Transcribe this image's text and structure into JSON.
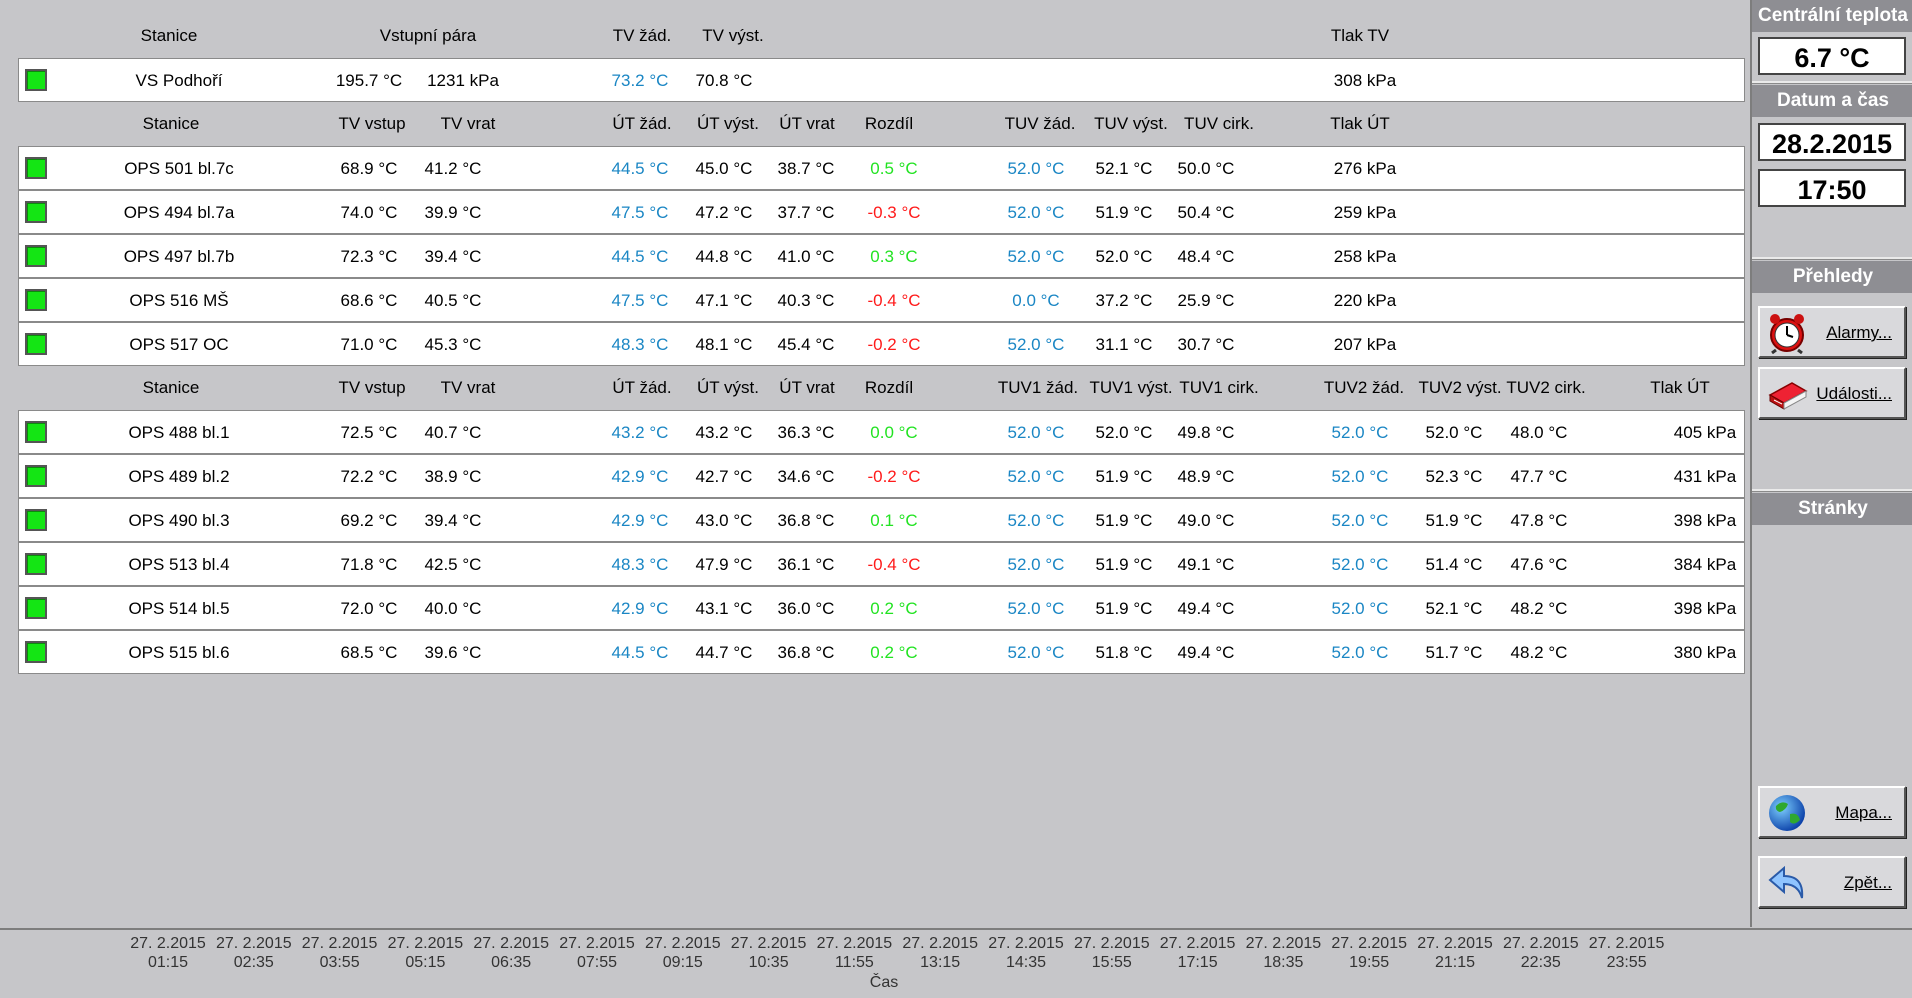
{
  "header1": {
    "stanice": "Stanice",
    "vstupni_para": "Vstupní pára",
    "tv_zad": "TV žád.",
    "tv_vyst": "TV výst.",
    "tlak_tv": "Tlak TV"
  },
  "vs_row": {
    "name": "VS Podhoří",
    "para_temp": "195.7 °C",
    "para_press": "1231 kPa",
    "tv_zad": "73.2 °C",
    "tv_vyst": "70.8 °C",
    "tlak": "308 kPa"
  },
  "header2": {
    "stanice": "Stanice",
    "tv_vstup": "TV vstup",
    "tv_vrat": "TV vrat",
    "ut_zad": "ÚT žád.",
    "ut_vyst": "ÚT výst.",
    "ut_vrat": "ÚT vrat",
    "rozdil": "Rozdíl",
    "tuv_zad": "TUV žád.",
    "tuv_vyst": "TUV výst.",
    "tuv_cirk": "TUV cirk.",
    "tlak_ut": "Tlak ÚT"
  },
  "group2": [
    {
      "name": "OPS 501 bl.7c",
      "tv_vstup": "68.9 °C",
      "tv_vrat": "41.2 °C",
      "ut_zad": "44.5 °C",
      "ut_vyst": "45.0 °C",
      "ut_vrat": "38.7 °C",
      "rozdil": "0.5 °C",
      "rozdil_sign": "pos",
      "tuv_zad": "52.0 °C",
      "tuv_vyst": "52.1 °C",
      "tuv_cirk": "50.0 °C",
      "tlak": "276 kPa"
    },
    {
      "name": "OPS 494 bl.7a",
      "tv_vstup": "74.0 °C",
      "tv_vrat": "39.9 °C",
      "ut_zad": "47.5 °C",
      "ut_vyst": "47.2 °C",
      "ut_vrat": "37.7 °C",
      "rozdil": "-0.3 °C",
      "rozdil_sign": "neg",
      "tuv_zad": "52.0 °C",
      "tuv_vyst": "51.9 °C",
      "tuv_cirk": "50.4 °C",
      "tlak": "259 kPa"
    },
    {
      "name": "OPS 497 bl.7b",
      "tv_vstup": "72.3 °C",
      "tv_vrat": "39.4 °C",
      "ut_zad": "44.5 °C",
      "ut_vyst": "44.8 °C",
      "ut_vrat": "41.0 °C",
      "rozdil": "0.3 °C",
      "rozdil_sign": "pos",
      "tuv_zad": "52.0 °C",
      "tuv_vyst": "52.0 °C",
      "tuv_cirk": "48.4 °C",
      "tlak": "258 kPa"
    },
    {
      "name": "OPS 516 MŠ",
      "tv_vstup": "68.6 °C",
      "tv_vrat": "40.5 °C",
      "ut_zad": "47.5 °C",
      "ut_vyst": "47.1 °C",
      "ut_vrat": "40.3 °C",
      "rozdil": "-0.4 °C",
      "rozdil_sign": "neg",
      "tuv_zad": "0.0 °C",
      "tuv_vyst": "37.2 °C",
      "tuv_cirk": "25.9 °C",
      "tlak": "220 kPa"
    },
    {
      "name": "OPS 517 OC",
      "tv_vstup": "71.0 °C",
      "tv_vrat": "45.3 °C",
      "ut_zad": "48.3 °C",
      "ut_vyst": "48.1 °C",
      "ut_vrat": "45.4 °C",
      "rozdil": "-0.2 °C",
      "rozdil_sign": "neg",
      "tuv_zad": "52.0 °C",
      "tuv_vyst": "31.1 °C",
      "tuv_cirk": "30.7 °C",
      "tlak": "207 kPa"
    }
  ],
  "header3": {
    "stanice": "Stanice",
    "tv_vstup": "TV vstup",
    "tv_vrat": "TV vrat",
    "ut_zad": "ÚT žád.",
    "ut_vyst": "ÚT výst.",
    "ut_vrat": "ÚT vrat",
    "rozdil": "Rozdíl",
    "tuv1_zad": "TUV1 žád.",
    "tuv1_vyst": "TUV1 výst.",
    "tuv1_cirk": "TUV1 cirk.",
    "tuv2_zad": "TUV2 žád.",
    "tuv2_vyst": "TUV2 výst.",
    "tuv2_cirk": "TUV2 cirk.",
    "tlak_ut": "Tlak ÚT"
  },
  "group3": [
    {
      "name": "OPS 488 bl.1",
      "tv_vstup": "72.5 °C",
      "tv_vrat": "40.7 °C",
      "ut_zad": "43.2 °C",
      "ut_vyst": "43.2 °C",
      "ut_vrat": "36.3 °C",
      "rozdil": "0.0 °C",
      "rozdil_sign": "pos",
      "tuv1_zad": "52.0 °C",
      "tuv1_vyst": "52.0 °C",
      "tuv1_cirk": "49.8 °C",
      "tuv2_zad": "52.0 °C",
      "tuv2_vyst": "52.0 °C",
      "tuv2_cirk": "48.0 °C",
      "tlak": "405 kPa"
    },
    {
      "name": "OPS 489 bl.2",
      "tv_vstup": "72.2 °C",
      "tv_vrat": "38.9 °C",
      "ut_zad": "42.9 °C",
      "ut_vyst": "42.7 °C",
      "ut_vrat": "34.6 °C",
      "rozdil": "-0.2 °C",
      "rozdil_sign": "neg",
      "tuv1_zad": "52.0 °C",
      "tuv1_vyst": "51.9 °C",
      "tuv1_cirk": "48.9 °C",
      "tuv2_zad": "52.0 °C",
      "tuv2_vyst": "52.3 °C",
      "tuv2_cirk": "47.7 °C",
      "tlak": "431 kPa"
    },
    {
      "name": "OPS 490 bl.3",
      "tv_vstup": "69.2 °C",
      "tv_vrat": "39.4 °C",
      "ut_zad": "42.9 °C",
      "ut_vyst": "43.0 °C",
      "ut_vrat": "36.8 °C",
      "rozdil": "0.1 °C",
      "rozdil_sign": "pos",
      "tuv1_zad": "52.0 °C",
      "tuv1_vyst": "51.9 °C",
      "tuv1_cirk": "49.0 °C",
      "tuv2_zad": "52.0 °C",
      "tuv2_vyst": "51.9 °C",
      "tuv2_cirk": "47.8 °C",
      "tlak": "398 kPa"
    },
    {
      "name": "OPS 513 bl.4",
      "tv_vstup": "71.8 °C",
      "tv_vrat": "42.5 °C",
      "ut_zad": "48.3 °C",
      "ut_vyst": "47.9 °C",
      "ut_vrat": "36.1 °C",
      "rozdil": "-0.4 °C",
      "rozdil_sign": "neg",
      "tuv1_zad": "52.0 °C",
      "tuv1_vyst": "51.9 °C",
      "tuv1_cirk": "49.1 °C",
      "tuv2_zad": "52.0 °C",
      "tuv2_vyst": "51.4 °C",
      "tuv2_cirk": "47.6 °C",
      "tlak": "384 kPa"
    },
    {
      "name": "OPS 514 bl.5",
      "tv_vstup": "72.0 °C",
      "tv_vrat": "40.0 °C",
      "ut_zad": "42.9 °C",
      "ut_vyst": "43.1 °C",
      "ut_vrat": "36.0 °C",
      "rozdil": "0.2 °C",
      "rozdil_sign": "pos",
      "tuv1_zad": "52.0 °C",
      "tuv1_vyst": "51.9 °C",
      "tuv1_cirk": "49.4 °C",
      "tuv2_zad": "52.0 °C",
      "tuv2_vyst": "52.1 °C",
      "tuv2_cirk": "48.2 °C",
      "tlak": "398 kPa"
    },
    {
      "name": "OPS 515 bl.6",
      "tv_vstup": "68.5 °C",
      "tv_vrat": "39.6 °C",
      "ut_zad": "44.5 °C",
      "ut_vyst": "44.7 °C",
      "ut_vrat": "36.8 °C",
      "rozdil": "0.2 °C",
      "rozdil_sign": "pos",
      "tuv1_zad": "52.0 °C",
      "tuv1_vyst": "51.8 °C",
      "tuv1_cirk": "49.4 °C",
      "tuv2_zad": "52.0 °C",
      "tuv2_vyst": "51.7 °C",
      "tuv2_cirk": "48.2 °C",
      "tlak": "380 kPa"
    }
  ],
  "side": {
    "central_temp_title": "Centrální teplota",
    "central_temp_value": "6.7 °C",
    "datetime_title": "Datum a čas",
    "date": "28.2.2015",
    "time": "17:50",
    "overviews_title": "Přehledy",
    "alarms_label": "Alarmy...",
    "events_label": "Události...",
    "pages_title": "Stránky",
    "map_label": "Mapa...",
    "back_label": "Zpět...",
    "icons": {
      "alarms": "alarm-clock-icon",
      "events": "event-book-icon",
      "map": "globe-icon",
      "back": "back-arrow-icon"
    }
  },
  "axis": {
    "title": "Čas",
    "ticks": [
      [
        "27. 2.2015",
        "01:15"
      ],
      [
        "27. 2.2015",
        "02:35"
      ],
      [
        "27. 2.2015",
        "03:55"
      ],
      [
        "27. 2.2015",
        "05:15"
      ],
      [
        "27. 2.2015",
        "06:35"
      ],
      [
        "27. 2.2015",
        "07:55"
      ],
      [
        "27. 2.2015",
        "09:15"
      ],
      [
        "27. 2.2015",
        "10:35"
      ],
      [
        "27. 2.2015",
        "11:55"
      ],
      [
        "27. 2.2015",
        "13:15"
      ],
      [
        "27. 2.2015",
        "14:35"
      ],
      [
        "27. 2.2015",
        "15:55"
      ],
      [
        "27. 2.2015",
        "17:15"
      ],
      [
        "27. 2.2015",
        "18:35"
      ],
      [
        "27. 2.2015",
        "19:55"
      ],
      [
        "27. 2.2015",
        "21:15"
      ],
      [
        "27. 2.2015",
        "22:35"
      ],
      [
        "27. 2.2015",
        "23:55"
      ]
    ]
  },
  "colors": {
    "setpoint_blue": "#1a86c4",
    "positive_green": "#22e322",
    "negative_red": "#ff1a1a",
    "status_ok": "#14e514"
  }
}
